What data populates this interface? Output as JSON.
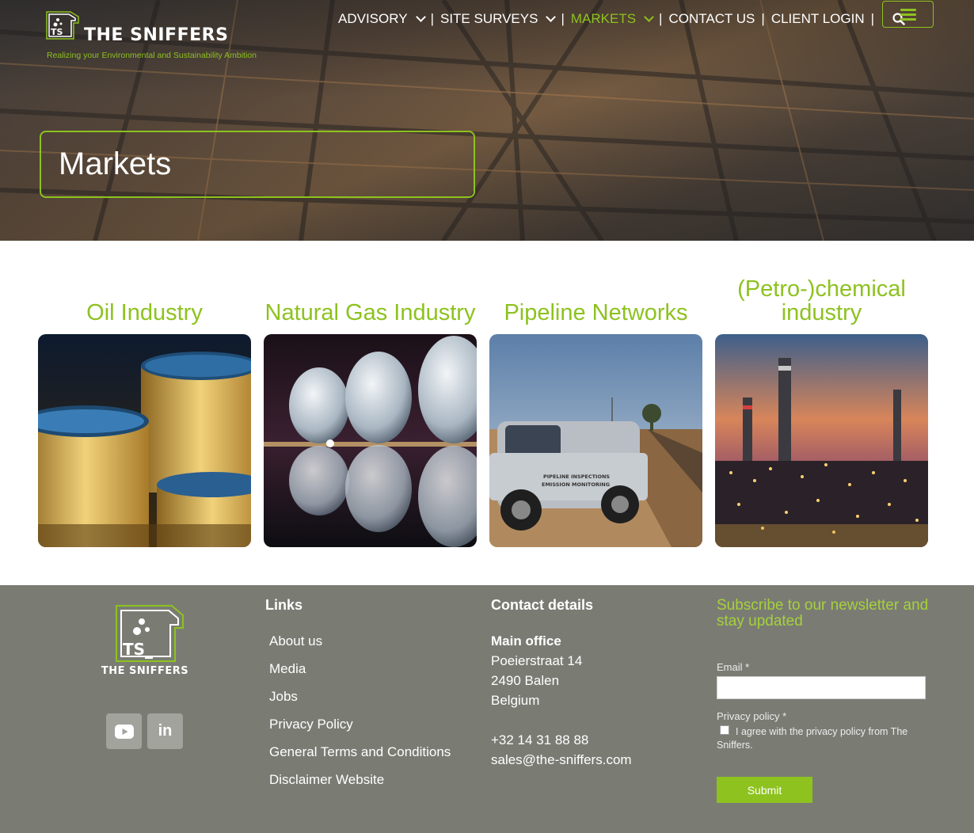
{
  "brand": {
    "name": "THE SNIFFERS",
    "badge_text": "TS_",
    "tagline": "Realizing your Environmental and Sustainability Ambition"
  },
  "nav": {
    "items": [
      {
        "label": "ADVISORY",
        "has_dropdown": true,
        "active": false
      },
      {
        "label": "SITE SURVEYS",
        "has_dropdown": true,
        "active": false
      },
      {
        "label": "MARKETS",
        "has_dropdown": true,
        "active": true
      },
      {
        "label": "CONTACT US",
        "has_dropdown": false,
        "active": false
      },
      {
        "label": "CLIENT LOGIN",
        "has_dropdown": false,
        "active": false
      }
    ],
    "separator": "|",
    "search_icon": "search-icon",
    "menu_icon": "hamburger-icon"
  },
  "hero": {
    "title": "Markets"
  },
  "markets": [
    {
      "title": "Oil Industry",
      "image": "oil storage tanks at night"
    },
    {
      "title": "Natural Gas Industry",
      "image": "spherical gas tanks reflected in water"
    },
    {
      "title": "Pipeline Networks",
      "image": "inspection pickup truck at pipeline trench"
    },
    {
      "title": "(Petro-)chemical industry",
      "image": "petrochemical plant at sunset"
    }
  ],
  "truck_text": {
    "line1": "PIPELINE INSPECTIONS",
    "line2": "EMISSION MONITORING"
  },
  "footer": {
    "brand_name": "THE SNIFFERS",
    "links_title": "Links",
    "links": [
      "About us",
      "Media",
      "Jobs",
      "Privacy Policy",
      "General Terms and Conditions",
      "Disclaimer Website"
    ],
    "contact_title": "Contact details",
    "office_label": "Main office",
    "street": "Poeierstraat 14",
    "city": "2490 Balen",
    "country": "Belgium",
    "phone": "+32 14 31 88 88",
    "email": "sales@the-sniffers.com",
    "newsletter_title": "Subscribe to our newsletter and stay updated",
    "email_label": "Email *",
    "email_value": "",
    "privacy_label": "Privacy policy *",
    "privacy_text": "I agree with the privacy policy from The Sniffers.",
    "privacy_checked": false,
    "submit_label": "Submit",
    "social": [
      {
        "name": "youtube-icon"
      },
      {
        "name": "linkedin-icon",
        "text": "in"
      }
    ]
  },
  "colors": {
    "accent": "#8dc21f",
    "footer_bg": "#7a7c74",
    "white": "#ffffff"
  }
}
